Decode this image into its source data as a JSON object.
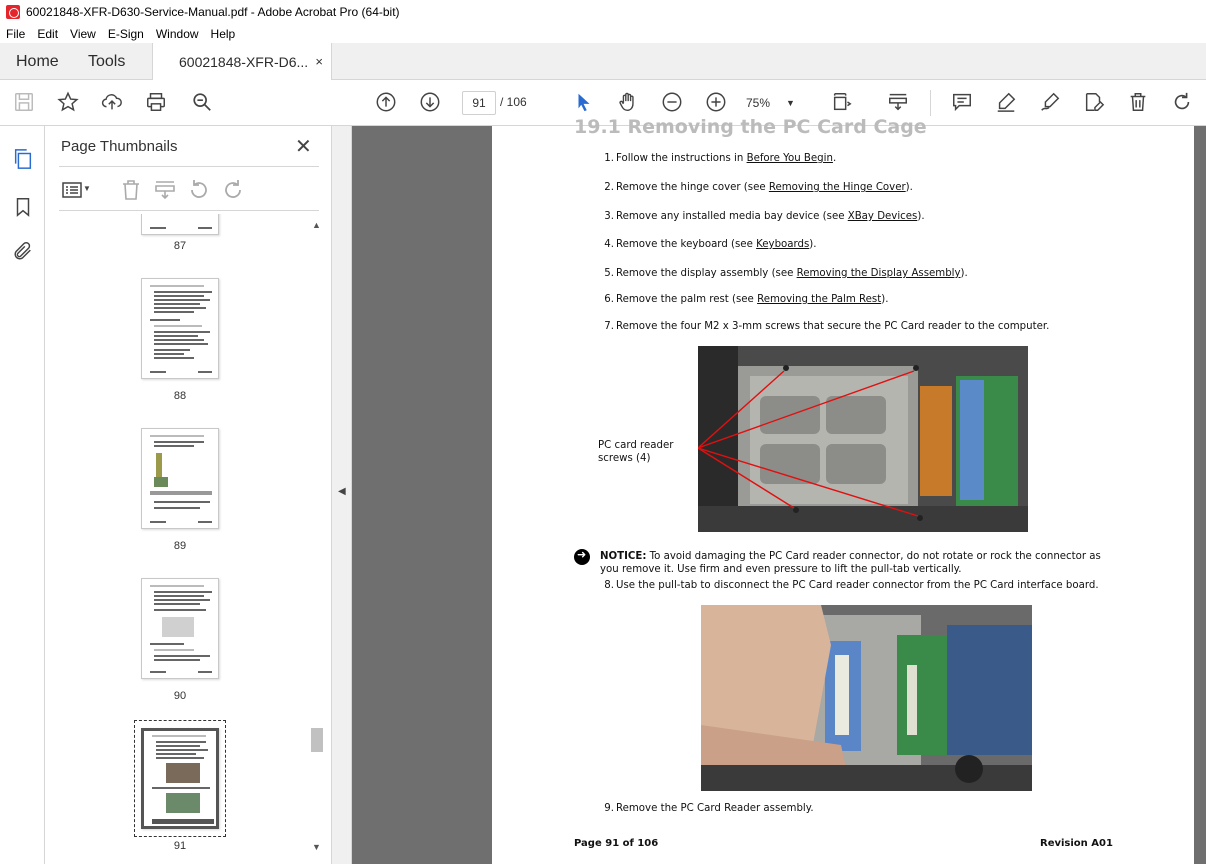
{
  "window": {
    "title": "60021848-XFR-D630-Service-Manual.pdf - Adobe Acrobat Pro (64-bit)"
  },
  "menu": [
    "File",
    "Edit",
    "View",
    "E-Sign",
    "Window",
    "Help"
  ],
  "tabs": {
    "home": "Home",
    "tools": "Tools",
    "doc": "60021848-XFR-D6...",
    "doc_close": "×"
  },
  "toolbar": {
    "page_current": "91",
    "page_total": "/ 106",
    "zoom": "75%",
    "icons": [
      "save-icon",
      "star-icon",
      "upload-icon",
      "print-icon",
      "zoom-search-icon",
      "page-up-icon",
      "page-down-icon",
      "select-arrow-icon",
      "hand-icon",
      "zoom-out-icon",
      "zoom-in-icon",
      "fit-page-icon",
      "scroll-mode-icon",
      "comment-icon",
      "highlight-icon",
      "sign-icon",
      "edit-icon",
      "delete-icon",
      "rotate-icon"
    ]
  },
  "panel": {
    "title": "Page Thumbnails",
    "close": "✕",
    "thumbs": [
      "87",
      "88",
      "89",
      "90",
      "91"
    ]
  },
  "doc": {
    "section": "19.1      Removing the PC Card Cage",
    "steps": [
      {
        "n": "1.",
        "pre": "Follow the instructions in ",
        "link": "Before You Begin",
        "post": "."
      },
      {
        "n": "2.",
        "pre": "Remove the hinge cover (see ",
        "link": "Removing the Hinge Cover",
        "post": ")."
      },
      {
        "n": "3.",
        "pre": "Remove any installed media bay device (see ",
        "link": "XBay Devices",
        "post": ")."
      },
      {
        "n": "4.",
        "pre": "Remove the keyboard (see ",
        "link": "Keyboards",
        "post": ")."
      },
      {
        "n": "5.",
        "pre": "Remove the display assembly (see ",
        "link": "Removing the Display Assembly",
        "post": ")."
      },
      {
        "n": "6.",
        "pre": "Remove the palm rest (see ",
        "link": "Removing the Palm Rest",
        "post": ")."
      },
      {
        "n": "7.",
        "pre": "Remove the four M2 x 3-mm screws that secure the PC Card reader to the computer.",
        "link": "",
        "post": ""
      }
    ],
    "callout_line1": "PC card reader",
    "callout_line2": "screws (4)",
    "notice_label": "NOTICE:",
    "notice_text": " To avoid damaging the PC Card reader connector, do not rotate or rock the connector as you remove it. Use firm and even pressure to lift the pull-tab vertically.",
    "step8_n": "8.",
    "step8": "Use the pull-tab to disconnect the PC Card reader connector from the PC Card interface board.",
    "step9_n": "9.",
    "step9": "Remove the PC Card Reader assembly.",
    "footer_left": "Page 91 of 106",
    "footer_right": "Revision A01"
  }
}
